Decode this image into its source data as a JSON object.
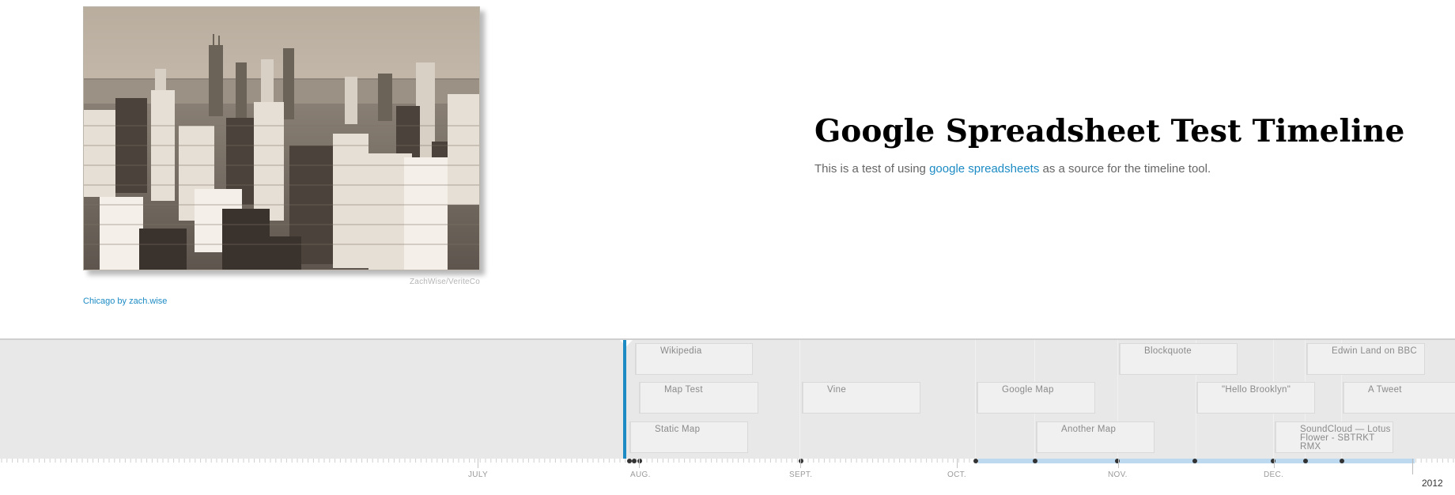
{
  "slide": {
    "title": "Google Spreadsheet Test Timeline",
    "description_before": "This is a test of using ",
    "description_link": "google spreadsheets",
    "description_after": " as a source for the timeline tool.",
    "image_credit": "ZachWise/VeriteCo",
    "image_caption": "Chicago by zach.wise"
  },
  "timeline": {
    "year": "2012",
    "months": [
      "JULY",
      "AUG.",
      "SEPT.",
      "OCT.",
      "NOV.",
      "DEC."
    ],
    "markers": [
      {
        "label": "Wikipedia"
      },
      {
        "label": "Map Test"
      },
      {
        "label": "Static Map"
      },
      {
        "label": "Vine"
      },
      {
        "label": "Google Map"
      },
      {
        "label": "Another Map"
      },
      {
        "label": "Blockquote"
      },
      {
        "label": "\"Hello Brooklyn\""
      },
      {
        "label": "SoundCloud — Lotus Flower - SBTRKT RMX"
      },
      {
        "label": "Edwin Land on BBC"
      },
      {
        "label": "A Tweet"
      }
    ]
  },
  "colors": {
    "accent": "#1c8bc4",
    "timeline_background": "#e8e8e8",
    "range_highlight": "#bcd9ef"
  }
}
